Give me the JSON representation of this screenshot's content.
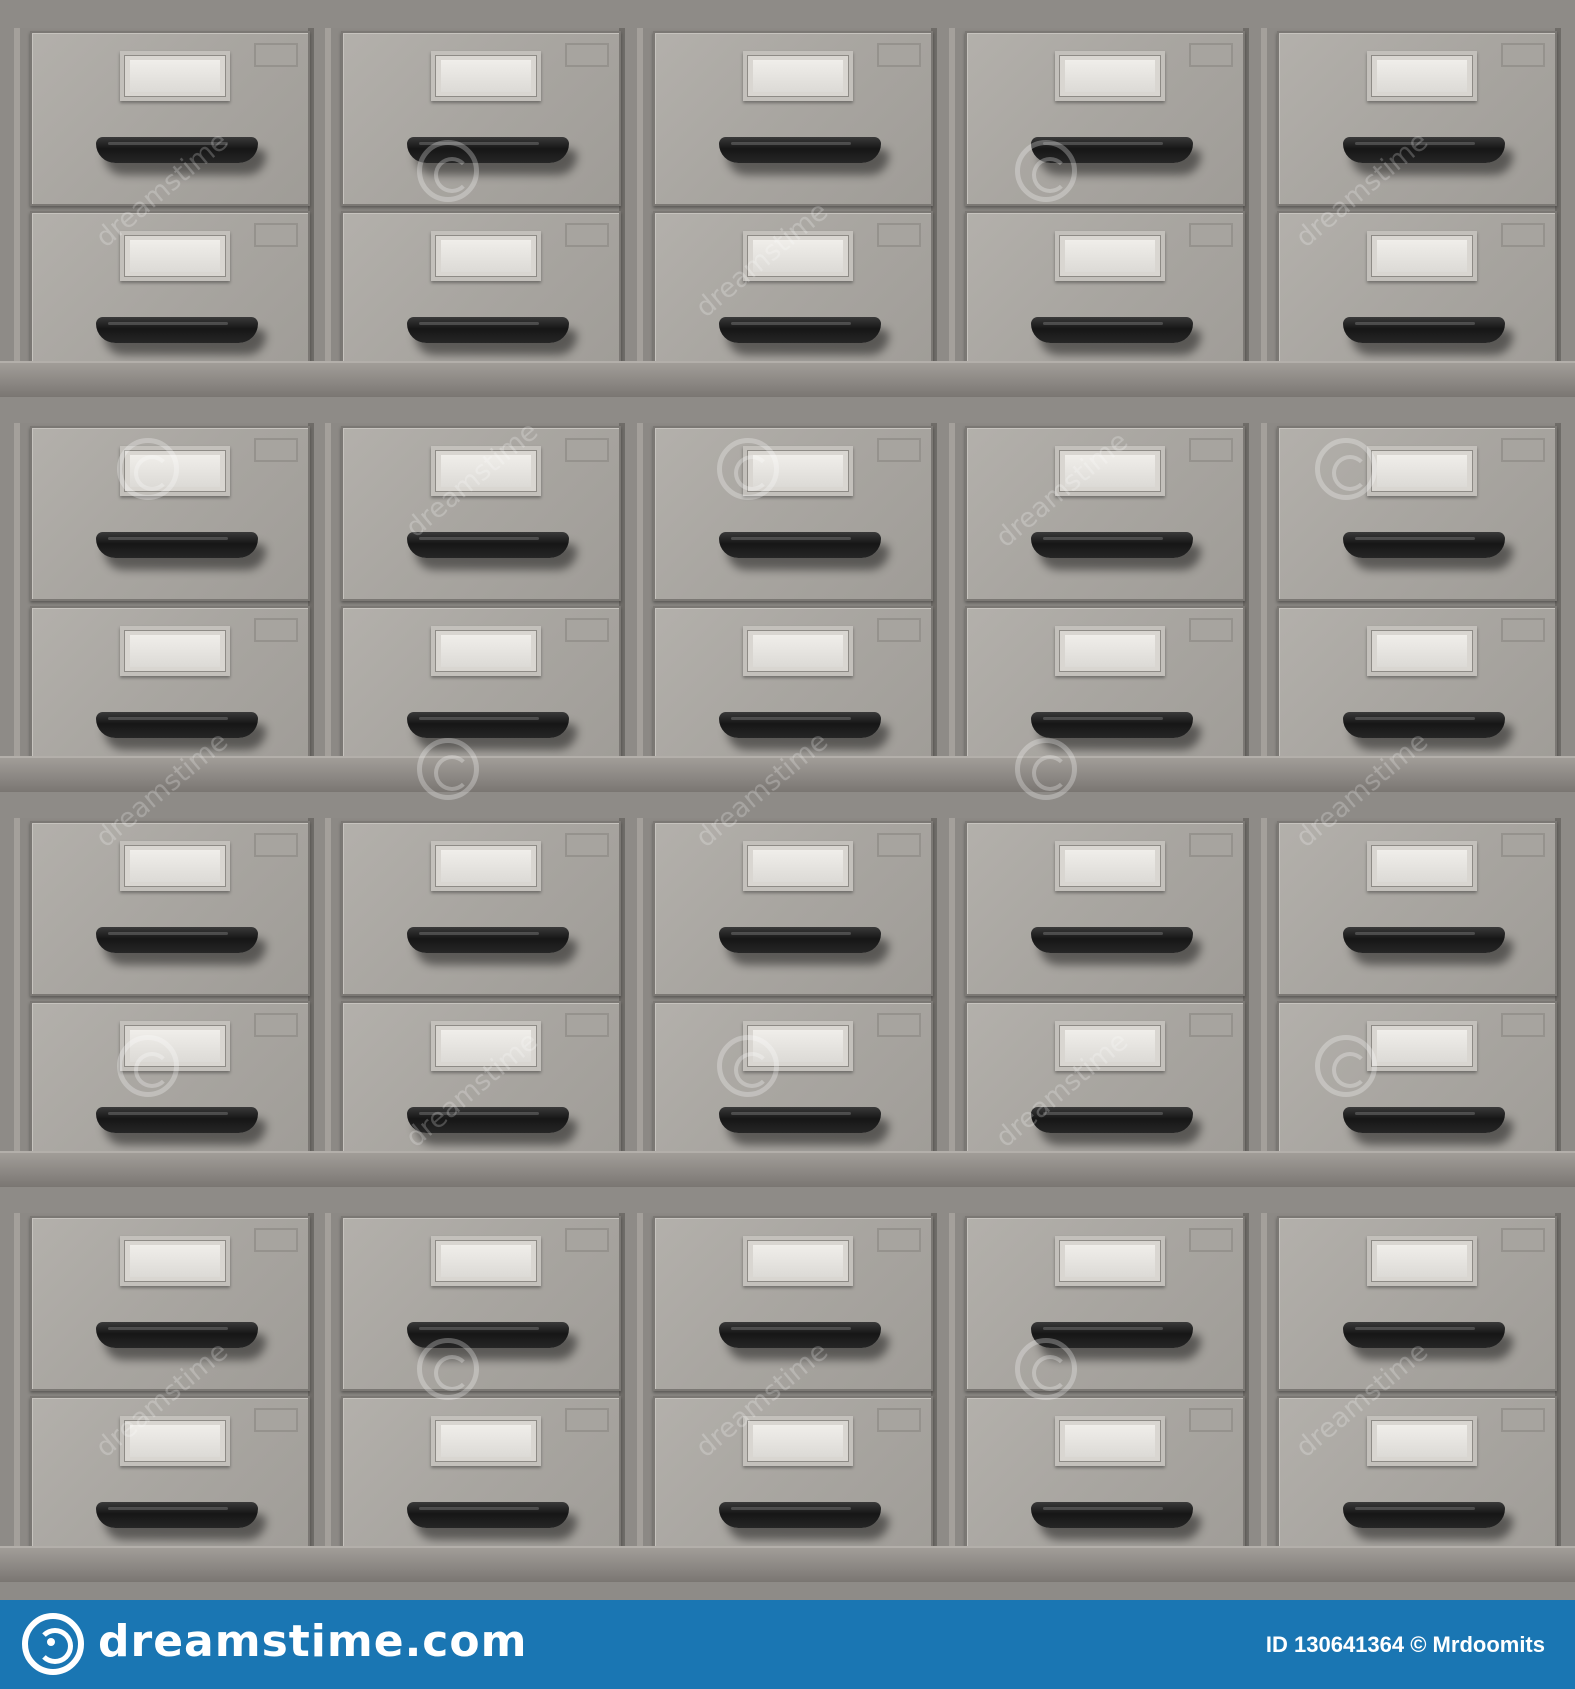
{
  "photo": {
    "subject": "metal card catalog cabinet drawers",
    "grid": {
      "shelves": 4,
      "cabinets_per_shelf": 5,
      "drawers_per_cabinet": 2
    },
    "colors": {
      "drawer": "#aaa7a2",
      "handle": "#1c1c1c",
      "label": "#e6e4e0",
      "frame": "#8c8985"
    },
    "watermark_text": "dreamstime"
  },
  "footer": {
    "site_name": "dreamstime.com",
    "credit": "ID 130641364 © Mrdoomits",
    "background": "#1a76b3",
    "logo_icon": "dreamstime-spiral-logo-icon"
  }
}
